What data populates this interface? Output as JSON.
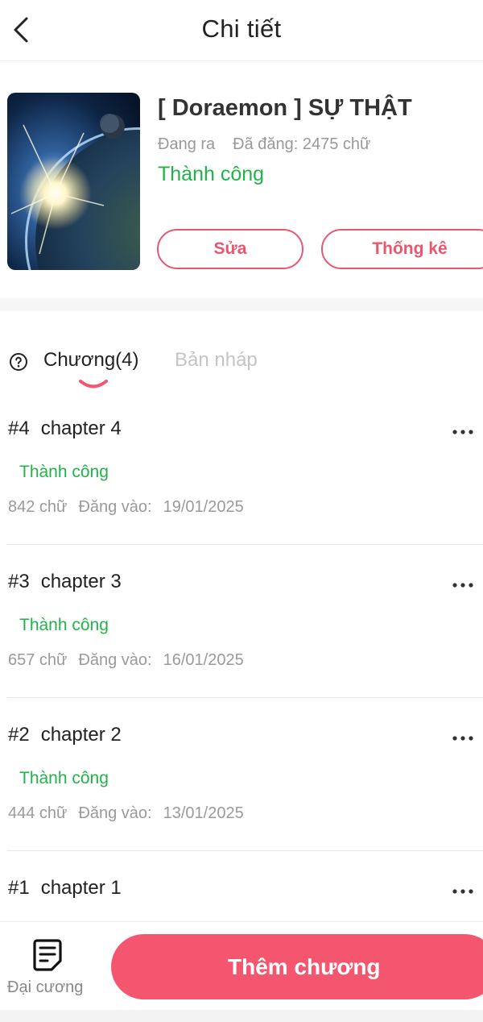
{
  "header": {
    "title": "Chi tiết",
    "back_icon": "chevron-left-icon"
  },
  "book": {
    "title": "[ Doraemon ] SỰ THẬT",
    "state": "Đang ra",
    "posted": "Đã đăng: 2475 chữ",
    "status": "Thành công",
    "edit_label": "Sửa",
    "stats_label": "Thống kê"
  },
  "tabs": {
    "chapters_label": "Chương(4)",
    "drafts_label": "Bản nháp",
    "help_icon": "question-circle-icon"
  },
  "chapters": [
    {
      "num": "#4",
      "title": "chapter 4",
      "status": "Thành công",
      "words": "842 chữ",
      "posted_label": "Đăng vào:",
      "date": "19/01/2025"
    },
    {
      "num": "#3",
      "title": "chapter 3",
      "status": "Thành công",
      "words": "657 chữ",
      "posted_label": "Đăng vào:",
      "date": "16/01/2025"
    },
    {
      "num": "#2",
      "title": "chapter 2",
      "status": "Thành công",
      "words": "444 chữ",
      "posted_label": "Đăng vào:",
      "date": "13/01/2025"
    },
    {
      "num": "#1",
      "title": "chapter 1"
    }
  ],
  "bottom": {
    "outline_label": "Đại cương",
    "outline_icon": "document-list-icon",
    "add_label": "Thêm chương"
  },
  "colors": {
    "accent": "#f3566e",
    "success": "#21b34a",
    "muted": "#999999"
  }
}
